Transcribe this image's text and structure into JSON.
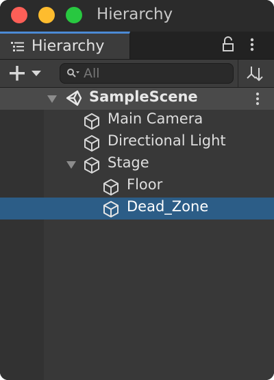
{
  "window": {
    "title": "Hierarchy"
  },
  "tab": {
    "label": "Hierarchy"
  },
  "search": {
    "placeholder": "All"
  },
  "scene": {
    "name": "SampleScene"
  },
  "tree": {
    "items": [
      {
        "label": "Main Camera"
      },
      {
        "label": "Directional Light"
      },
      {
        "label": "Stage"
      },
      {
        "label": "Floor"
      },
      {
        "label": "Dead_Zone"
      }
    ]
  },
  "colors": {
    "accent": "#4c8bd5",
    "selection": "#2c5d87",
    "close": "#fe5f57",
    "minimize": "#febc2e",
    "maximize": "#28c840"
  },
  "icons": {
    "tab": "list-icon",
    "lock": "lock-icon",
    "more": "more-vertical-icon",
    "add": "plus-icon",
    "search": "search-icon",
    "sort": "sort-icon",
    "scene": "unity-logo-icon",
    "object": "cube-icon"
  }
}
